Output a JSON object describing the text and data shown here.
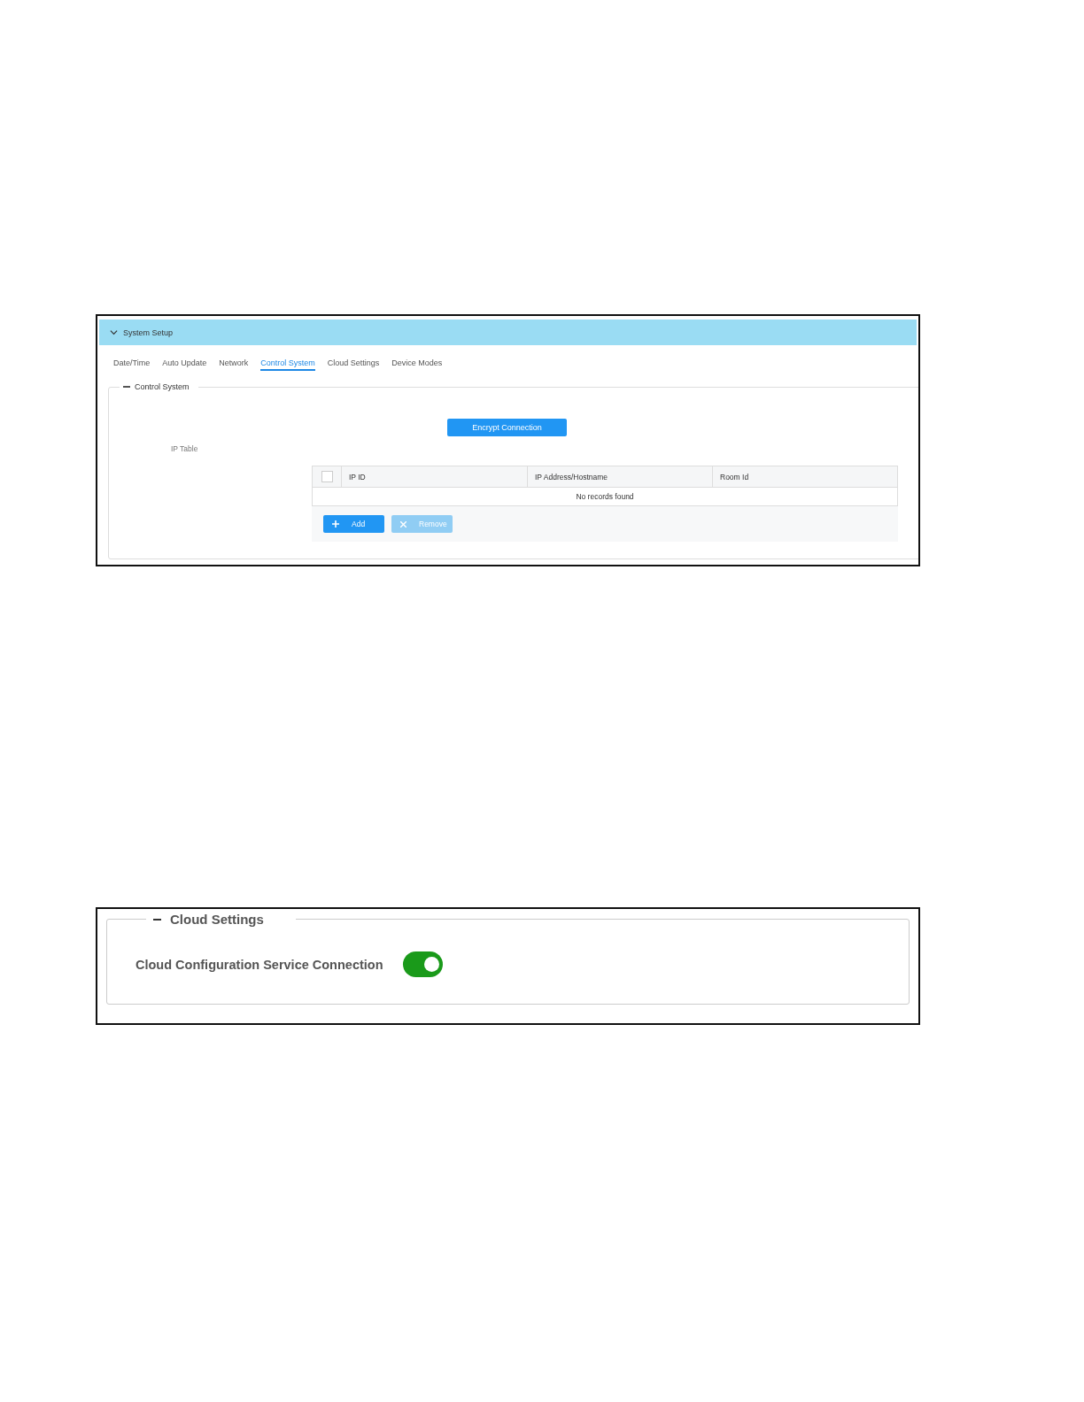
{
  "system_setup": {
    "title": "System Setup",
    "expanded": true,
    "tabs": [
      {
        "label": "Date/Time",
        "selected": false
      },
      {
        "label": "Auto Update",
        "selected": false
      },
      {
        "label": "Network",
        "selected": false
      },
      {
        "label": "Control System",
        "selected": true
      },
      {
        "label": "Cloud Settings",
        "selected": false
      },
      {
        "label": "Device Modes",
        "selected": false
      }
    ],
    "section": {
      "title": "Control System",
      "expanded": true,
      "encrypt_button": "Encrypt Connection",
      "ip_table": {
        "label": "IP Table",
        "select_all_checked": false,
        "columns": [
          "IP ID",
          "IP Address/Hostname",
          "Room Id"
        ],
        "empty_message": "No records found",
        "buttons": [
          {
            "kind": "add",
            "label": "Add",
            "disabled": false
          },
          {
            "kind": "remove",
            "label": "Remove",
            "disabled": true
          }
        ]
      }
    }
  },
  "cloud_settings": {
    "title": "Cloud Settings",
    "expanded": true,
    "rows": [
      {
        "label": "Cloud Configuration Service Connection",
        "on": true
      }
    ]
  }
}
